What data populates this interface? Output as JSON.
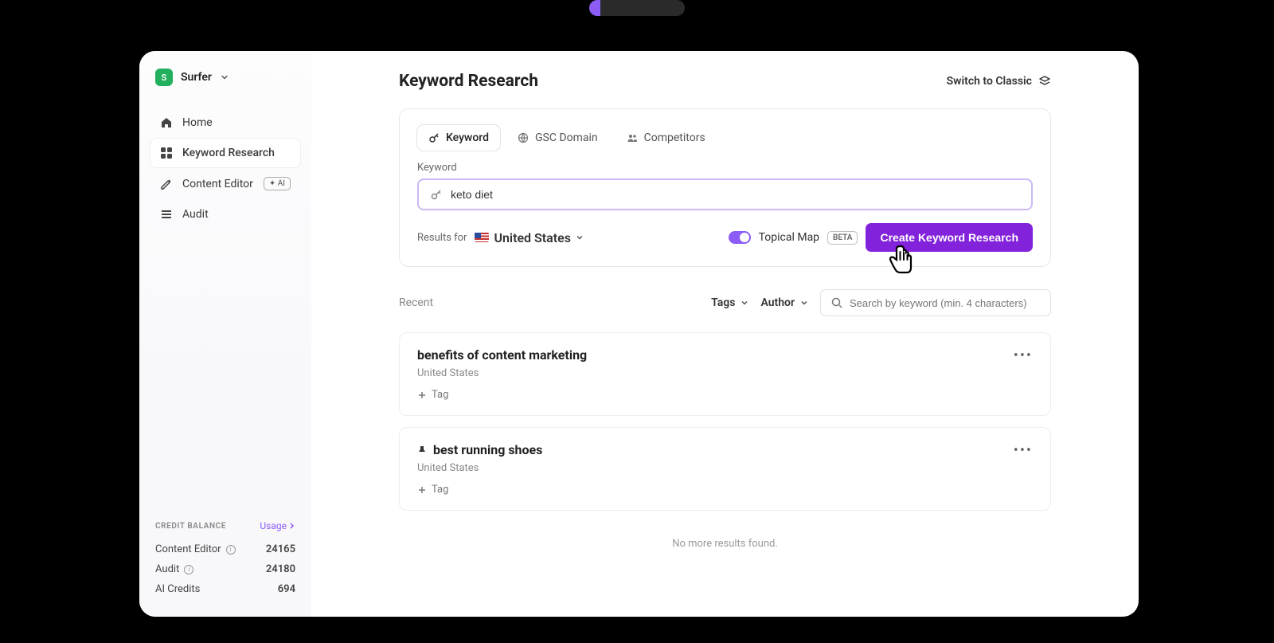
{
  "brand": {
    "initial": "S",
    "name": "Surfer"
  },
  "sidebar": {
    "items": [
      {
        "label": "Home"
      },
      {
        "label": "Keyword Research"
      },
      {
        "label": "Content Editor",
        "badge": "✦ AI"
      },
      {
        "label": "Audit"
      }
    ]
  },
  "credits": {
    "title": "CREDIT BALANCE",
    "usage_link": "Usage",
    "rows": [
      {
        "label": "Content Editor",
        "value": "24165",
        "info": true
      },
      {
        "label": "Audit",
        "value": "24180",
        "info": true
      },
      {
        "label": "AI Credits",
        "value": "694",
        "info": false
      }
    ]
  },
  "page": {
    "title": "Keyword Research",
    "switch_classic": "Switch to Classic"
  },
  "tabs": [
    {
      "label": "Keyword"
    },
    {
      "label": "GSC Domain"
    },
    {
      "label": "Competitors"
    }
  ],
  "keyword": {
    "label": "Keyword",
    "value": "keto diet"
  },
  "results_for": {
    "label": "Results for",
    "country": "United States"
  },
  "topical": {
    "label": "Topical Map",
    "badge": "BETA"
  },
  "create_button": "Create Keyword Research",
  "filters": {
    "recent": "Recent",
    "tags": "Tags",
    "author": "Author",
    "search_placeholder": "Search by keyword (min. 4 characters)"
  },
  "results": [
    {
      "title": "benefits of content marketing",
      "location": "United States",
      "tag_label": "Tag",
      "pinned": false
    },
    {
      "title": "best running shoes",
      "location": "United States",
      "tag_label": "Tag",
      "pinned": true
    }
  ],
  "no_more": "No more results found."
}
